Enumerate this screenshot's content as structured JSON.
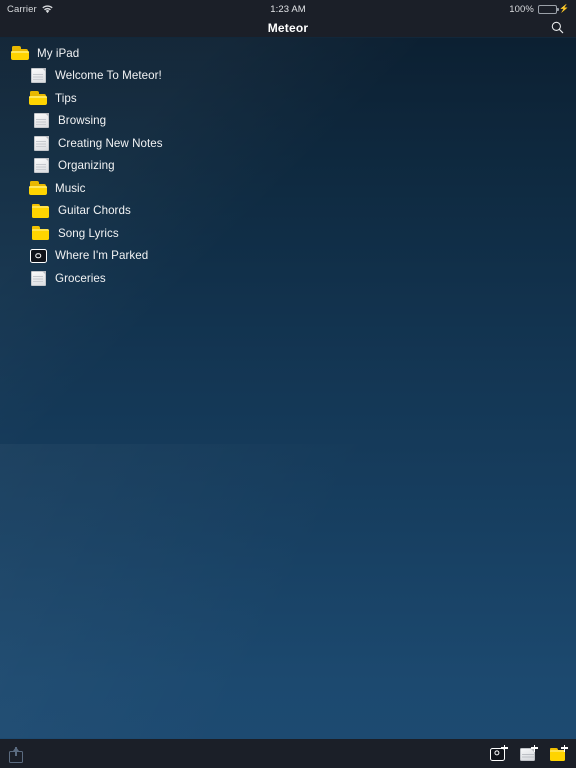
{
  "status_bar": {
    "carrier": "Carrier",
    "wifi_icon": "wifi-icon",
    "time": "1:23 AM",
    "battery_percent": "100%",
    "battery_level": 100,
    "battery_icon": "battery-full-icon",
    "charging_icon": "lightning-bolt-icon",
    "background_color": "#1b1f28"
  },
  "nav_bar": {
    "title": "Meteor",
    "search_icon": "search-icon"
  },
  "content": {
    "gradient_top_color": "#0c2032",
    "gradient_bottom_color": "#1d4a71"
  },
  "tree": {
    "items": [
      {
        "label": "My iPad",
        "icon": "folder-open-icon",
        "level": 0
      },
      {
        "label": "Welcome To Meteor!",
        "icon": "note-icon",
        "level": 1
      },
      {
        "label": "Tips",
        "icon": "folder-open-icon",
        "level": 1
      },
      {
        "label": "Browsing",
        "icon": "note-icon",
        "level": 2
      },
      {
        "label": "Creating New Notes",
        "icon": "note-icon",
        "level": 2
      },
      {
        "label": "Organizing",
        "icon": "note-icon",
        "level": 2
      },
      {
        "label": "Music",
        "icon": "folder-open-icon",
        "level": 1
      },
      {
        "label": "Guitar Chords",
        "icon": "folder-closed-icon",
        "level": 2
      },
      {
        "label": "Song Lyrics",
        "icon": "folder-closed-icon",
        "level": 2
      },
      {
        "label": "Where I'm Parked",
        "icon": "camera-note-icon",
        "level": 1
      },
      {
        "label": "Groceries",
        "icon": "note-icon",
        "level": 1
      }
    ]
  },
  "toolbar": {
    "share_icon": "share-icon",
    "share_enabled": false,
    "new_photo_note_icon": "camera-plus-icon",
    "new_note_icon": "note-plus-icon",
    "new_folder_icon": "folder-plus-icon",
    "background_color": "#1b1f28"
  },
  "colors": {
    "folder_yellow": "#ffd400",
    "battery_green": "#4cd764",
    "text_primary": "#f2f3f4"
  }
}
